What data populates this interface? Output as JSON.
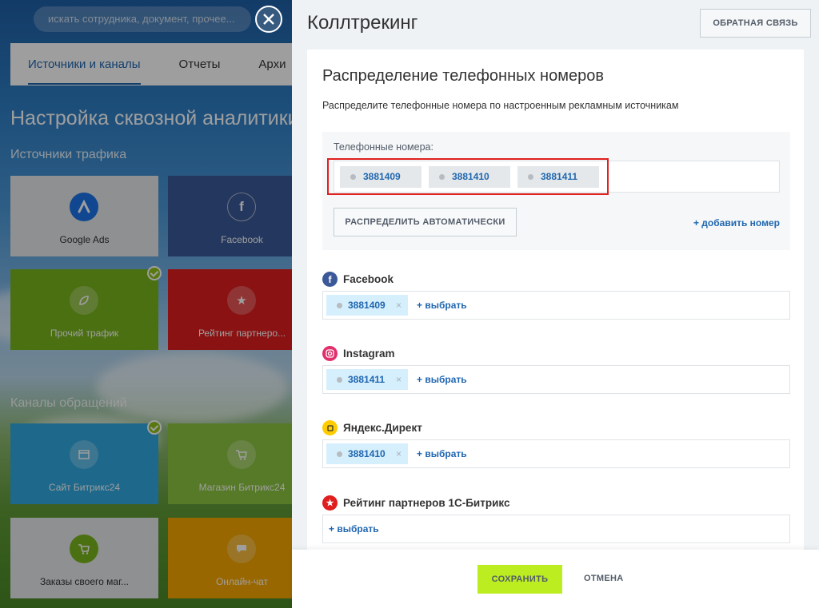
{
  "background": {
    "search_placeholder": "искать сотрудника, документ, прочее...",
    "tabs": [
      {
        "label": "Источники и каналы"
      },
      {
        "label": "Отчеты"
      },
      {
        "label": "Архи"
      }
    ],
    "title": "Настройка сквозной аналитики",
    "traffic_heading": "Источники трафика",
    "channels_heading": "Каналы обращений",
    "tiles": [
      {
        "label": "Google Ads",
        "color": "#e6e8ea"
      },
      {
        "label": "Facebook",
        "color": "#3b5998"
      },
      {
        "label": "Прочий трафик",
        "color": "#7ab51d"
      },
      {
        "label": "Рейтинг партнеро...",
        "color": "#e01e1e"
      },
      {
        "label": "Сайт Битрикс24",
        "color": "#2fa8e0"
      },
      {
        "label": "Магазин Битрикс24",
        "color": "#8cc63f"
      },
      {
        "label": "Заказы своего маг...",
        "color": "#e6e8ea"
      },
      {
        "label": "Онлайн-чат",
        "color": "#f7a700"
      }
    ]
  },
  "panel": {
    "title": "Коллтрекинг",
    "feedback_label": "ОБРАТНАЯ СВЯЗЬ",
    "card_title": "Распределение телефонных номеров",
    "card_description": "Распределите телефонные номера по настроенным рекламным источникам",
    "phones_label": "Телефонные номера:",
    "phones": [
      "3881409",
      "3881410",
      "3881411"
    ],
    "auto_distribute_label": "РАСПРЕДЕЛИТЬ АВТОМАТИЧЕСКИ",
    "add_number_label": "+ добавить номер",
    "sources": [
      {
        "name": "Facebook",
        "number": "3881409",
        "icon": "facebook-icon",
        "color": "#3b5998"
      },
      {
        "name": "Instagram",
        "number": "3881411",
        "icon": "instagram-icon",
        "color": "#e1306c"
      },
      {
        "name": "Яндекс.Директ",
        "number": "3881410",
        "icon": "yandex-direct-icon",
        "color": "#ffcc00"
      },
      {
        "name": "Рейтинг партнеров 1С-Битрикс",
        "number": "",
        "icon": "star-icon",
        "color": "#e01e1e"
      }
    ],
    "choose_label": "+ выбрать",
    "remove_glyph": "×",
    "save_label": "СОХРАНИТЬ",
    "cancel_label": "ОТМЕНА"
  }
}
